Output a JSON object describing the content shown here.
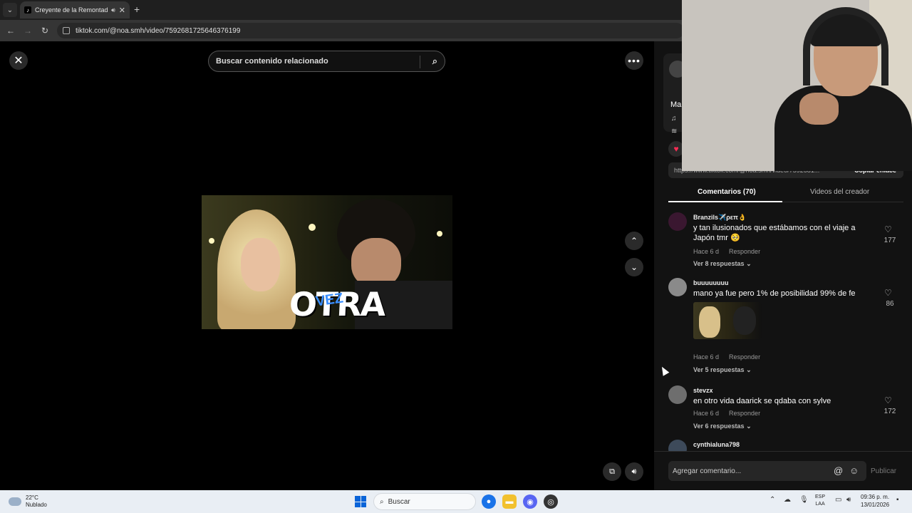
{
  "browser": {
    "tab_title": "Creyente de la Remontada",
    "tab_favicon": "tiktok-icon",
    "url": "tiktok.com/@noa.smh/video/7592681725646376199"
  },
  "video": {
    "search_placeholder": "Buscar contenido relacionado",
    "overlay_text": "OTRA",
    "overlay_text_accent": "VEZ"
  },
  "panel": {
    "author_name": "Ma",
    "copy_link_url": "https://www.tiktok.com/@noa.smh/video/7592681...",
    "copy_link_label": "Copiar enlace",
    "tabs": [
      {
        "label": "Comentarios (70)",
        "active": true
      },
      {
        "label": "Videos del creador",
        "active": false
      }
    ],
    "comments": [
      {
        "user": "Branzils✈️ρεπ👌",
        "text": "y tan ilusionados que estábamos con el viaje a Japón tmr 🥺",
        "time": "Hace 6 d",
        "reply": "Responder",
        "replies": "Ver 8 respuestas",
        "likes": "177"
      },
      {
        "user": "buuuuuuuu",
        "text": "mano ya fue pero 1% de posibilidad 99% de fe",
        "time": "Hace 6 d",
        "reply": "Responder",
        "replies": "Ver 5 respuestas",
        "likes": "86"
      },
      {
        "user": "stevzx",
        "text": "en otro vida daarick se qdaba con sylve",
        "time": "Hace 6 d",
        "reply": "Responder",
        "replies": "Ver 6 respuestas",
        "likes": "172"
      },
      {
        "user": "cynthialuna798",
        "text": "",
        "time": "",
        "reply": "",
        "replies": "",
        "likes": ""
      }
    ],
    "comment_placeholder": "Agregar comentario...",
    "publish_label": "Publicar"
  },
  "taskbar": {
    "weather_temp": "22°C",
    "weather_desc": "Nublado",
    "search_label": "Buscar",
    "lang_line1": "ESP",
    "lang_line2": "LAA",
    "time": "09:36 p. m.",
    "date": "13/01/2026"
  },
  "colors": {
    "accent_like": "#fe2c55",
    "panel_bg": "#121212",
    "taskbar_bg": "#e9eef4"
  }
}
